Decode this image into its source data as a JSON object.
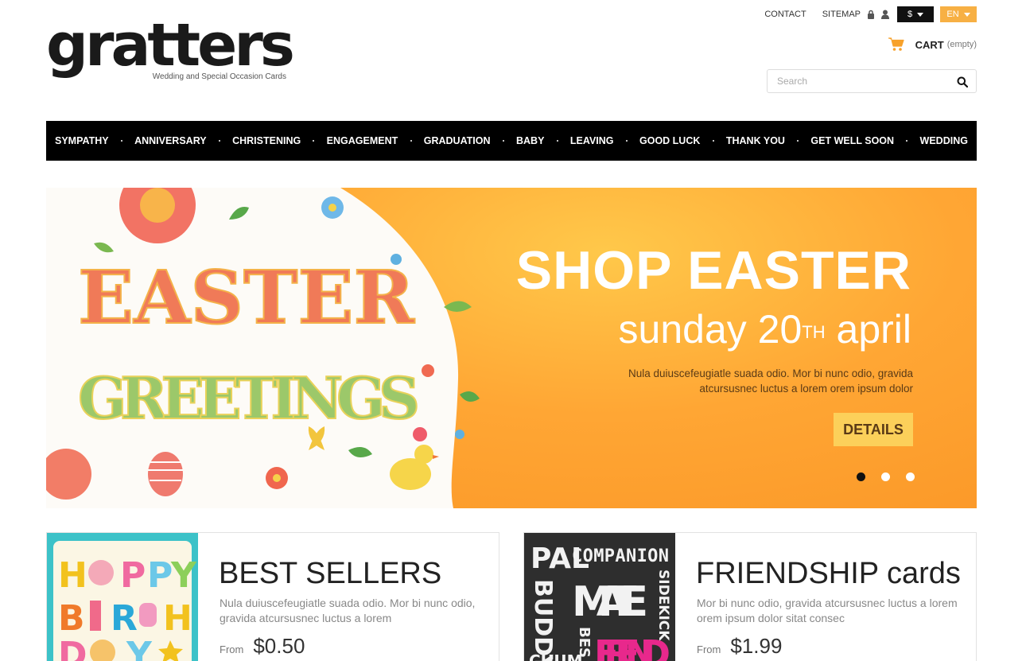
{
  "logo": {
    "text": "gratters",
    "tagline": "Wedding and Special Occasion Cards"
  },
  "top_links": {
    "contact": "CONTACT",
    "sitemap": "SITEMAP"
  },
  "currency": {
    "selected": "$"
  },
  "language": {
    "selected": "EN"
  },
  "cart": {
    "label": "CART",
    "status": "(empty)"
  },
  "search": {
    "placeholder": "Search"
  },
  "nav": {
    "items": [
      "SYMPATHY",
      "ANNIVERSARY",
      "CHRISTENING",
      "ENGAGEMENT",
      "GRADUATION",
      "BABY",
      "LEAVING",
      "GOOD LUCK",
      "THANK YOU",
      "GET WELL SOON",
      "WEDDING"
    ]
  },
  "banner": {
    "title": "SHOP EASTER",
    "subtitle_pre": "sunday 20",
    "subtitle_sup": "TH",
    "subtitle_post": " april",
    "description": "Nula duiuscefeugiatle suada odio. Mor bi nunc odio, gravida atcursusnec luctus a lorem orem ipsum dolor",
    "button": "DETAILS",
    "art_line1": "EASTER",
    "art_line2": "GREETINGS",
    "slides_total": 3,
    "active_slide": 1
  },
  "promos": [
    {
      "title": "BEST SELLERS",
      "description": "Nula duiuscefeugiatle suada odio. Mor bi nunc odio, gravida atcursusnec luctus a lorem",
      "from_label": "From",
      "price": "$0.50",
      "thumb_text": [
        "H",
        "P",
        "P",
        "Y",
        "B",
        "R",
        "H",
        "D",
        "Y"
      ]
    },
    {
      "title": "FRIENDSHIP cards",
      "description": "Mor bi nunc odio, gravida atcursusnec luctus a lorem orem ipsum dolor sitat consec",
      "from_label": "From",
      "price": "$1.99",
      "thumb_text": [
        "PAL",
        "COMPANION",
        "BUDDY",
        "MATE",
        "SIDEKICK",
        "BES",
        "FRIEND",
        "CHUM"
      ]
    }
  ],
  "colors": {
    "accent": "#f7b044",
    "banner": "#ffa634",
    "nav_bg": "#000000",
    "button": "#fcd05a"
  }
}
